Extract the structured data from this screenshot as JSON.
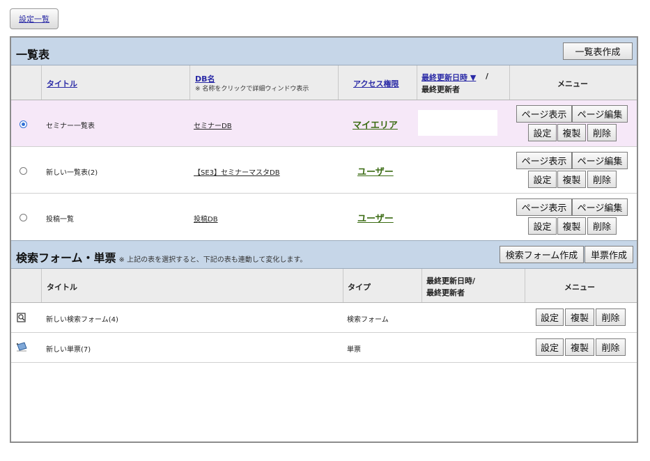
{
  "top_link": "設定一覧",
  "list_section": {
    "title": "一覧表",
    "create_button": "一覧表作成",
    "columns": {
      "title": "タイトル",
      "db_name": "DB名",
      "db_note": "※ 名称をクリックで詳細ウィンドウ表示",
      "access": "アクセス権限",
      "updated_line1": "最終更新日時 ▼",
      "updated_sep": "/",
      "updated_line2": "最終更新者",
      "menu": "メニュー"
    },
    "rows": [
      {
        "title": "セミナー一覧表",
        "db": "セミナーDB",
        "access": "マイエリア",
        "selected": true
      },
      {
        "title": "新しい一覧表(2)",
        "db": "【SE3】セミナーマスタDB",
        "access": "ユーザー",
        "selected": false
      },
      {
        "title": "投稿一覧",
        "db": "投稿DB",
        "access": "ユーザー",
        "selected": false
      }
    ],
    "row_buttons": {
      "page_view": "ページ表示",
      "page_edit": "ページ編集",
      "settings": "設定",
      "duplicate": "複製",
      "delete": "削除"
    }
  },
  "form_section": {
    "title": "検索フォーム・単票",
    "note": "※ 上記の表を選択すると、下記の表も連動して変化します。",
    "create_form_button": "検索フォーム作成",
    "create_card_button": "単票作成",
    "columns": {
      "title": "タイトル",
      "type": "タイプ",
      "updated_line1": "最終更新日時/",
      "updated_line2": "最終更新者",
      "menu": "メニュー"
    },
    "rows": [
      {
        "icon": "search-form-icon",
        "title": "新しい検索フォーム(4)",
        "type": "検索フォーム"
      },
      {
        "icon": "card-icon",
        "title": "新しい単票(7)",
        "type": "単票"
      }
    ],
    "row_buttons": {
      "settings": "設定",
      "duplicate": "複製",
      "delete": "削除"
    }
  },
  "colors": {
    "header_bg": "#c6d6e8",
    "selected_row_bg": "#f6e8f8",
    "access_green": "#3a6b12",
    "link_blue": "#2a2aa6"
  }
}
